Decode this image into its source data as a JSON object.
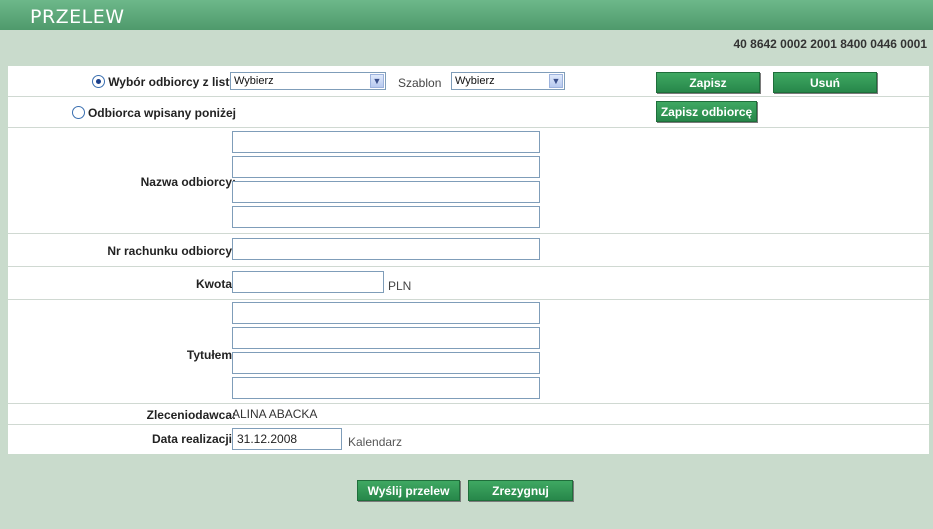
{
  "header": {
    "title": "PRZELEW"
  },
  "account_number": "40 8642 0002 2001 8400 0446 0001",
  "recipient_select": {
    "from_list_label": "Wybór odbiorcy z listy",
    "from_list_value": "Wybierz",
    "template_label": "Szablon",
    "template_value": "Wybierz",
    "save_label": "Zapisz",
    "delete_label": "Usuń",
    "manual_label": "Odbiorca wpisany poniżej",
    "save_recipient_label": "Zapisz odbiorcę"
  },
  "form": {
    "recipient_name_label": "Nazwa odbiorcy:",
    "recipient_name_lines": [
      "",
      "",
      "",
      ""
    ],
    "account_label": "Nr rachunku odbiorcy:",
    "account_value": "",
    "amount_label": "Kwota:",
    "amount_value": "",
    "currency": "PLN",
    "title_label": "Tytułem:",
    "title_lines": [
      "",
      "",
      "",
      ""
    ],
    "principal_label": "Zleceniodawca:",
    "principal_value": "ALINA ABACKA",
    "date_label": "Data realizacji:",
    "date_value": "31.12.2008",
    "calendar_label": "Kalendarz"
  },
  "actions": {
    "send_label": "Wyślij przelew",
    "cancel_label": "Zrezygnuj"
  },
  "colors": {
    "header": "#4f9a6c",
    "background": "#c9dbcc",
    "button": "#2e9553"
  }
}
